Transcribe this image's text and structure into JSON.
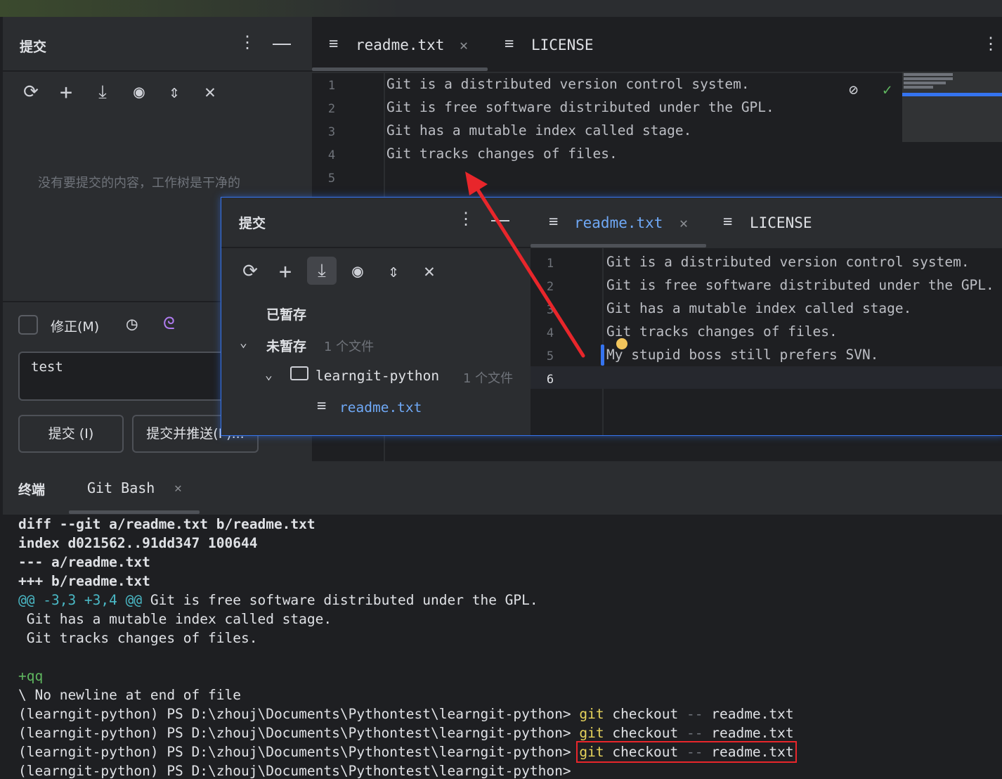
{
  "commit_panel": {
    "title": "提交",
    "empty_message": "没有要提交的内容，工作树是干净的",
    "amend_label": "修正(M)",
    "message_value": "test",
    "commit_button": "提交 (I)",
    "commit_push_button": "提交并推送(P)..."
  },
  "editor": {
    "tabs": [
      {
        "label": "readme.txt"
      },
      {
        "label": "LICENSE"
      }
    ],
    "lines": [
      {
        "no": "1",
        "text": "Git is a distributed version control system."
      },
      {
        "no": "2",
        "text": "Git is free software distributed under the GPL."
      },
      {
        "no": "3",
        "text": "Git has a mutable index called stage."
      },
      {
        "no": "4",
        "text": "Git tracks changes of files."
      },
      {
        "no": "5",
        "text": ""
      }
    ]
  },
  "popup": {
    "title": "提交",
    "staged_label": "已暂存",
    "unstaged_label": "未暂存",
    "unstaged_count": "1 个文件",
    "repo_label": "learngit-python",
    "repo_count": "1 个文件",
    "file_label": "readme.txt",
    "tabs": [
      {
        "label": "readme.txt"
      },
      {
        "label": "LICENSE"
      }
    ],
    "lines": [
      {
        "no": "1",
        "text": "Git is a distributed version control system."
      },
      {
        "no": "2",
        "text": "Git is free software distributed under the GPL."
      },
      {
        "no": "3",
        "text": "Git has a mutable index called stage."
      },
      {
        "no": "4",
        "text": "Git tracks changes of files."
      },
      {
        "no": "5",
        "text": "My stupid boss still prefers SVN."
      },
      {
        "no": "6",
        "text": ""
      }
    ]
  },
  "terminal": {
    "title": "终端",
    "tab_label": "Git Bash",
    "lines": [
      "diff --git a/readme.txt b/readme.txt",
      "index d021562..91dd347 100644",
      "--- a/readme.txt",
      "+++ b/readme.txt",
      "@@ -3,3 +3,4 @@",
      " Git is free software distributed under the GPL.",
      " Git has a mutable index called stage.",
      " Git tracks changes of files.",
      "",
      "+qq",
      "\\ No newline at end of file"
    ],
    "prompt": "(learngit-python) PS D:\\zhouj\\Documents\\Pythontest\\learngit-python>",
    "cmd_git": "git",
    "cmd_checkout": "checkout",
    "cmd_dashes": "--",
    "cmd_file": "readme.txt"
  },
  "colors": {
    "accent": "#3574f0",
    "annotation_red": "#e8262b",
    "cmd_yellow": "#e6d35b",
    "hunk_teal": "#4ab9c6",
    "added_green": "#5fb65f"
  }
}
